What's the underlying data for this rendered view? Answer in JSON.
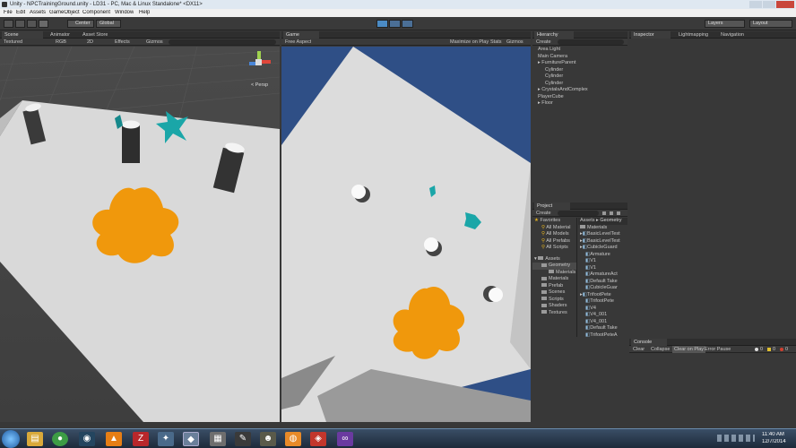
{
  "window_title": "Unity - NPCTrainingGround.unity - LD31 - PC, Mac & Linux Standalone* <DX11>",
  "menu": [
    "File",
    "Edit",
    "Assets",
    "GameObject",
    "Component",
    "Window",
    "Help"
  ],
  "toolbar": {
    "center_label": "Center",
    "global_label": "Global",
    "layers_label": "Layers",
    "layout_label": "Layout"
  },
  "scene_panel": {
    "tabs": [
      "Scene",
      "Animator",
      "Asset Store"
    ],
    "shading": "Textured",
    "mode": "RGB",
    "view2d": "2D",
    "effects": "Effects",
    "gizmos": "Gizmos",
    "persp_label": "< Persp"
  },
  "game_panel": {
    "tab": "Game",
    "aspect": "Free Aspect",
    "options": [
      "Maximize on Play",
      "Stats",
      "Gizmos"
    ]
  },
  "hierarchy": {
    "tab": "Hierarchy",
    "create": "Create",
    "items": [
      {
        "label": "Area Light",
        "indent": 0
      },
      {
        "label": "Main Camera",
        "indent": 0
      },
      {
        "label": "FurnitureParent",
        "indent": 0,
        "arrow": true
      },
      {
        "label": "Cylinder",
        "indent": 1
      },
      {
        "label": "Cylinder",
        "indent": 1
      },
      {
        "label": "Cylinder",
        "indent": 1
      },
      {
        "label": "CrystalsAndComplex",
        "indent": 0,
        "arrow": true
      },
      {
        "label": "PlayerCube",
        "indent": 0
      },
      {
        "label": "Floor",
        "indent": 0,
        "arrow": true
      }
    ]
  },
  "inspector": {
    "tabs": [
      "Inspector",
      "Lightmapping",
      "Navigation"
    ]
  },
  "project": {
    "tab": "Project",
    "create": "Create",
    "favorites_label": "Favorites",
    "favorites": [
      "All Material",
      "All Models",
      "All Prefabs",
      "All Scripts"
    ],
    "assets_label": "Assets",
    "folders": [
      "Geometry",
      "Materials",
      "Materials",
      "Prefab",
      "Scenes",
      "Scripts",
      "Shaders",
      "Textures"
    ],
    "breadcrumb": [
      "Assets",
      "Geometry"
    ],
    "files": [
      {
        "label": "Materials",
        "indent": 0,
        "kind": "folder"
      },
      {
        "label": "BasicLevelTest",
        "indent": 0,
        "kind": "model",
        "arrow": true
      },
      {
        "label": "BasicLevelTest",
        "indent": 0,
        "kind": "model",
        "arrow": true
      },
      {
        "label": "CubicleGuard",
        "indent": 0,
        "kind": "model",
        "arrow": true
      },
      {
        "label": "Armature",
        "indent": 1,
        "kind": "model"
      },
      {
        "label": "V1",
        "indent": 1,
        "kind": "model"
      },
      {
        "label": "V1",
        "indent": 1,
        "kind": "model"
      },
      {
        "label": "ArmatureAct",
        "indent": 1,
        "kind": "model"
      },
      {
        "label": "Default Take",
        "indent": 1,
        "kind": "model"
      },
      {
        "label": "CubicleGuar",
        "indent": 1,
        "kind": "model"
      },
      {
        "label": "TrifootPete",
        "indent": 0,
        "kind": "model",
        "arrow": true
      },
      {
        "label": "TrifootPete",
        "indent": 1,
        "kind": "model"
      },
      {
        "label": "V4",
        "indent": 1,
        "kind": "model"
      },
      {
        "label": "V4_001",
        "indent": 1,
        "kind": "model"
      },
      {
        "label": "V4_001",
        "indent": 1,
        "kind": "model"
      },
      {
        "label": "Default Take",
        "indent": 1,
        "kind": "model"
      },
      {
        "label": "TrifootPeteA",
        "indent": 1,
        "kind": "model"
      },
      {
        "label": "TrifootPeteA",
        "indent": 1,
        "kind": "model"
      }
    ]
  },
  "console": {
    "tab": "Console",
    "buttons": [
      "Clear",
      "Collapse",
      "Clear on Play",
      "Error Pause"
    ],
    "counts": [
      "0",
      "0",
      "0"
    ]
  },
  "taskbar": {
    "time": "11:40 AM",
    "date": "12/7/2014"
  },
  "colors": {
    "orange_blob": "#f0980c",
    "teal": "#1aa6a8",
    "game_bg": "#2f4f86"
  }
}
